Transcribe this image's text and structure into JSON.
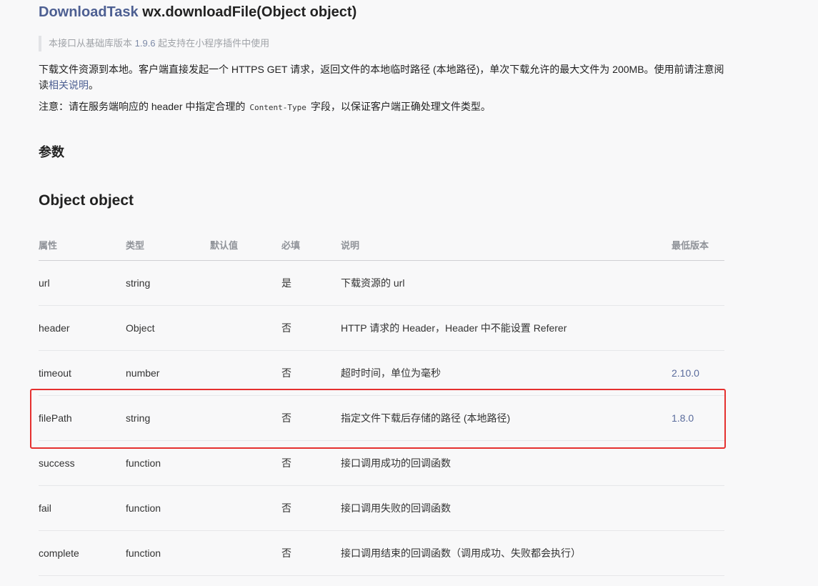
{
  "header": {
    "type_name": "DownloadTask",
    "signature": "wx.downloadFile(Object object)"
  },
  "tip": {
    "prefix": "本接口从基础库版本 ",
    "version": "1.9.6",
    "suffix": " 起支持在小程序插件中使用"
  },
  "description": {
    "line1_prefix": "下载文件资源到本地。客户端直接发起一个 HTTPS GET 请求，返回文件的本地临时路径 (本地路径)，单次下载允许的最大文件为 200MB。使用前请注意阅读",
    "link_text": "相关说明",
    "line1_suffix": "。",
    "note_prefix": "注意：请在服务端响应的 header 中指定合理的",
    "note_code": "Content-Type",
    "note_suffix": "字段，以保证客户端正确处理文件类型。"
  },
  "section_params": "参数",
  "section_object": "Object object",
  "table": {
    "headers": [
      "属性",
      "类型",
      "默认值",
      "必填",
      "说明",
      "最低版本"
    ],
    "rows": [
      {
        "name": "url",
        "type": "string",
        "default": "",
        "required": "是",
        "desc": "下载资源的 url",
        "version": ""
      },
      {
        "name": "header",
        "type": "Object",
        "default": "",
        "required": "否",
        "desc": "HTTP 请求的 Header，Header 中不能设置 Referer",
        "version": ""
      },
      {
        "name": "timeout",
        "type": "number",
        "default": "",
        "required": "否",
        "desc": "超时时间，单位为毫秒",
        "version": "2.10.0"
      },
      {
        "name": "filePath",
        "type": "string",
        "default": "",
        "required": "否",
        "desc": "指定文件下载后存储的路径 (本地路径)",
        "version": "1.8.0"
      },
      {
        "name": "success",
        "type": "function",
        "default": "",
        "required": "否",
        "desc": "接口调用成功的回调函数",
        "version": ""
      },
      {
        "name": "fail",
        "type": "function",
        "default": "",
        "required": "否",
        "desc": "接口调用失败的回调函数",
        "version": ""
      },
      {
        "name": "complete",
        "type": "function",
        "default": "",
        "required": "否",
        "desc": "接口调用结束的回调函数（调用成功、失败都会执行）",
        "version": ""
      }
    ]
  },
  "colors": {
    "accent": "#4d5f92",
    "highlight_border": "#e5302f"
  }
}
